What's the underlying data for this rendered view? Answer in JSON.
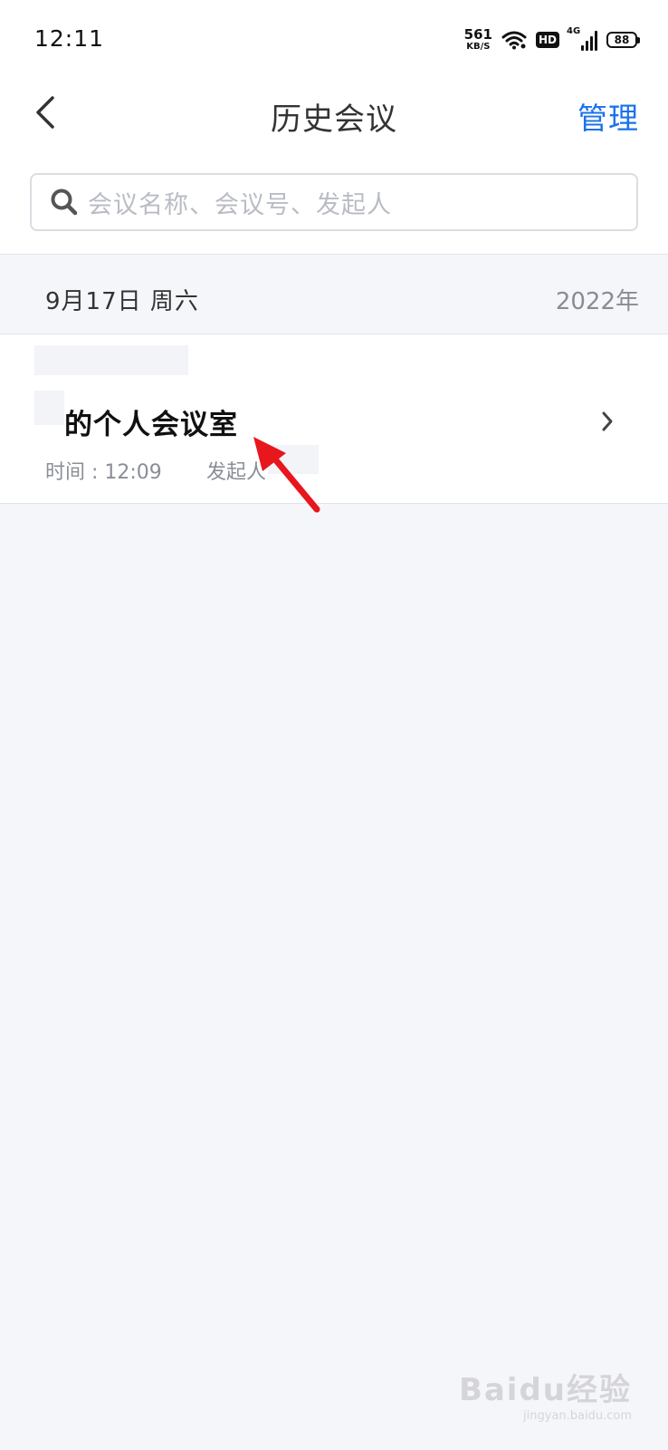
{
  "status_bar": {
    "time": "12:11",
    "net_speed_value": "561",
    "net_speed_unit": "KB/S",
    "hd_badge": "HD",
    "network_type": "4G",
    "battery_level": "88",
    "icons": [
      "wifi-icon",
      "hd-icon",
      "signal-icon",
      "battery-icon"
    ]
  },
  "nav": {
    "title": "历史会议",
    "manage_label": "管理",
    "back_icon": "chevron-left-icon"
  },
  "search": {
    "placeholder": "会议名称、会议号、发起人",
    "icon": "search-icon"
  },
  "section": {
    "date": "9月17日 周六",
    "year": "2022年"
  },
  "meetings": [
    {
      "title": "的个人会议室",
      "time": "时间 : 12:09",
      "host_label": "发起人"
    }
  ],
  "watermark": {
    "logo": "Baidu经验",
    "url": "jingyan.baidu.com"
  },
  "colors": {
    "accent": "#1a73e8",
    "page_bg": "#f5f6fa",
    "annotation_arrow": "#e8161d"
  }
}
